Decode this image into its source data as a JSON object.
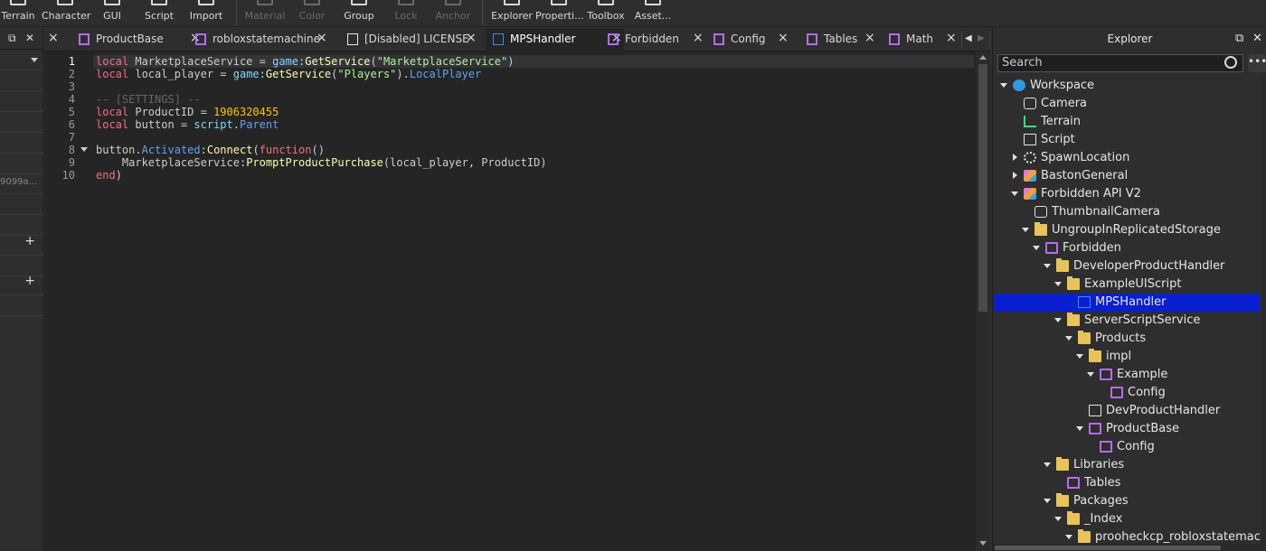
{
  "toolbar": {
    "items": [
      {
        "label": "Terrain",
        "enabled": true
      },
      {
        "label": "Character",
        "enabled": true
      },
      {
        "label": "GUI",
        "enabled": true
      },
      {
        "label": "Script",
        "enabled": true
      },
      {
        "label": "Import",
        "enabled": true
      },
      {
        "label": "Material",
        "enabled": false
      },
      {
        "label": "Color",
        "enabled": false
      },
      {
        "label": "Group",
        "enabled": true
      },
      {
        "label": "Lock",
        "enabled": false
      },
      {
        "label": "Anchor",
        "enabled": false
      },
      {
        "label": "Explorer",
        "enabled": true
      },
      {
        "label": "Properti...",
        "enabled": true
      },
      {
        "label": "Toolbox",
        "enabled": true
      },
      {
        "label": "Asset...",
        "enabled": true
      }
    ]
  },
  "left_panel": {
    "row_text": "9099a...",
    "plus": "+"
  },
  "tabs": [
    {
      "label": "ProductBase",
      "icon": "module-script-icon",
      "active": false
    },
    {
      "label": "robloxstatemachine",
      "icon": "module-script-icon",
      "active": false
    },
    {
      "label": "[Disabled] LICENSE",
      "icon": "script-icon",
      "active": false
    },
    {
      "label": "MPSHandler",
      "icon": "local-script-icon",
      "active": true
    },
    {
      "label": "Forbidden",
      "icon": "module-script-icon",
      "active": false
    },
    {
      "label": "Config",
      "icon": "module-script-icon",
      "active": false
    },
    {
      "label": "Tables",
      "icon": "module-script-icon",
      "active": false
    },
    {
      "label": "Math",
      "icon": "module-script-icon",
      "active": false
    }
  ],
  "editor": {
    "current_line": 1,
    "lines": [
      [
        {
          "t": "local ",
          "c": "kw"
        },
        {
          "t": "MarketplaceService",
          "c": "id"
        },
        {
          "t": " = ",
          "c": "op"
        },
        {
          "t": "game",
          "c": "gl"
        },
        {
          "t": ":",
          "c": "op"
        },
        {
          "t": "GetService",
          "c": "fn"
        },
        {
          "t": "(",
          "c": "op"
        },
        {
          "t": "\"MarketplaceService\"",
          "c": "str"
        },
        {
          "t": ")",
          "c": "op"
        }
      ],
      [
        {
          "t": "local ",
          "c": "kw"
        },
        {
          "t": "local_player",
          "c": "id"
        },
        {
          "t": " = ",
          "c": "op"
        },
        {
          "t": "game",
          "c": "gl"
        },
        {
          "t": ":",
          "c": "op"
        },
        {
          "t": "GetService",
          "c": "fn"
        },
        {
          "t": "(",
          "c": "op"
        },
        {
          "t": "\"Players\"",
          "c": "str"
        },
        {
          "t": ").",
          "c": "op"
        },
        {
          "t": "LocalPlayer",
          "c": "prop"
        }
      ],
      [],
      [
        {
          "t": "-- [SETTINGS] --",
          "c": "cm"
        }
      ],
      [
        {
          "t": "local ",
          "c": "kw"
        },
        {
          "t": "ProductID",
          "c": "id"
        },
        {
          "t": " = ",
          "c": "op"
        },
        {
          "t": "1906320455",
          "c": "num"
        }
      ],
      [
        {
          "t": "local ",
          "c": "kw"
        },
        {
          "t": "button",
          "c": "id"
        },
        {
          "t": " = ",
          "c": "op"
        },
        {
          "t": "script",
          "c": "gl"
        },
        {
          "t": ".",
          "c": "op"
        },
        {
          "t": "Parent",
          "c": "prop"
        }
      ],
      [],
      [
        {
          "t": "button",
          "c": "id"
        },
        {
          "t": ".",
          "c": "op"
        },
        {
          "t": "Activated",
          "c": "prop"
        },
        {
          "t": ":",
          "c": "op"
        },
        {
          "t": "Connect",
          "c": "fn"
        },
        {
          "t": "(",
          "c": "op"
        },
        {
          "t": "function",
          "c": "kw"
        },
        {
          "t": "()",
          "c": "op"
        }
      ],
      [
        {
          "t": "    MarketplaceService",
          "c": "id"
        },
        {
          "t": ":",
          "c": "op"
        },
        {
          "t": "PromptProductPurchase",
          "c": "fn"
        },
        {
          "t": "(",
          "c": "op"
        },
        {
          "t": "local_player",
          "c": "id"
        },
        {
          "t": ", ",
          "c": "op"
        },
        {
          "t": "ProductID",
          "c": "id"
        },
        {
          "t": ")",
          "c": "op"
        }
      ],
      [
        {
          "t": "end",
          "c": "kw"
        },
        {
          "t": ")",
          "c": "op"
        }
      ]
    ],
    "fold_lines": [
      8
    ]
  },
  "syntax_colors": {
    "kw": "#f86d7c",
    "id": "#cccccc",
    "op": "#cccccc",
    "gl": "#84d6f7",
    "fn": "#fdfbac",
    "str": "#adf195",
    "prop": "#61a1f1",
    "num": "#ffc600",
    "cm": "#666666"
  },
  "explorer": {
    "title": "Explorer",
    "search_placeholder": "Search",
    "more_label": "•••",
    "tree": [
      {
        "label": "Workspace",
        "depth": 0,
        "arrow": "open",
        "icon": "workspace-globe-icon"
      },
      {
        "label": "Camera",
        "depth": 1,
        "arrow": "none",
        "icon": "camera-icon"
      },
      {
        "label": "Terrain",
        "depth": 1,
        "arrow": "none",
        "icon": "terrain-icon"
      },
      {
        "label": "Script",
        "depth": 1,
        "arrow": "none",
        "icon": "script-icon"
      },
      {
        "label": "SpawnLocation",
        "depth": 1,
        "arrow": "closed",
        "icon": "spawn-gear-icon"
      },
      {
        "label": "BastonGeneral",
        "depth": 1,
        "arrow": "closed",
        "icon": "model-icon"
      },
      {
        "label": "Forbidden API V2",
        "depth": 1,
        "arrow": "open",
        "icon": "model-icon"
      },
      {
        "label": "ThumbnailCamera",
        "depth": 2,
        "arrow": "none",
        "icon": "camera-icon"
      },
      {
        "label": "UngroupInReplicatedStorage",
        "depth": 2,
        "arrow": "open",
        "icon": "folder-icon"
      },
      {
        "label": "Forbidden",
        "depth": 3,
        "arrow": "open",
        "icon": "module-script-icon"
      },
      {
        "label": "DeveloperProductHandler",
        "depth": 4,
        "arrow": "open",
        "icon": "folder-icon"
      },
      {
        "label": "ExampleUIScript",
        "depth": 5,
        "arrow": "open",
        "icon": "folder-icon"
      },
      {
        "label": "MPSHandler",
        "depth": 6,
        "arrow": "none",
        "icon": "local-script-icon",
        "selected": true
      },
      {
        "label": "ServerScriptService",
        "depth": 5,
        "arrow": "open",
        "icon": "folder-icon"
      },
      {
        "label": "Products",
        "depth": 6,
        "arrow": "open",
        "icon": "folder-icon"
      },
      {
        "label": "impl",
        "depth": 7,
        "arrow": "open",
        "icon": "folder-icon"
      },
      {
        "label": "Example",
        "depth": 8,
        "arrow": "open",
        "icon": "module-script-icon"
      },
      {
        "label": "Config",
        "depth": 9,
        "arrow": "none",
        "icon": "module-script-icon"
      },
      {
        "label": "DevProductHandler",
        "depth": 7,
        "arrow": "none",
        "icon": "script-icon"
      },
      {
        "label": "ProductBase",
        "depth": 7,
        "arrow": "open",
        "icon": "module-script-icon"
      },
      {
        "label": "Config",
        "depth": 8,
        "arrow": "none",
        "icon": "module-script-icon"
      },
      {
        "label": "Libraries",
        "depth": 4,
        "arrow": "open",
        "icon": "folder-icon"
      },
      {
        "label": "Tables",
        "depth": 5,
        "arrow": "none",
        "icon": "module-script-icon"
      },
      {
        "label": "Packages",
        "depth": 4,
        "arrow": "open",
        "icon": "folder-icon"
      },
      {
        "label": "_Index",
        "depth": 5,
        "arrow": "open",
        "icon": "folder-icon"
      },
      {
        "label": "prooheckcp_robloxstatemachi",
        "depth": 6,
        "arrow": "open",
        "icon": "folder-icon"
      }
    ]
  },
  "colors": {
    "selection": "#0a1fd0",
    "editor_bg": "#252526",
    "panel_bg": "#2e2e2e"
  }
}
